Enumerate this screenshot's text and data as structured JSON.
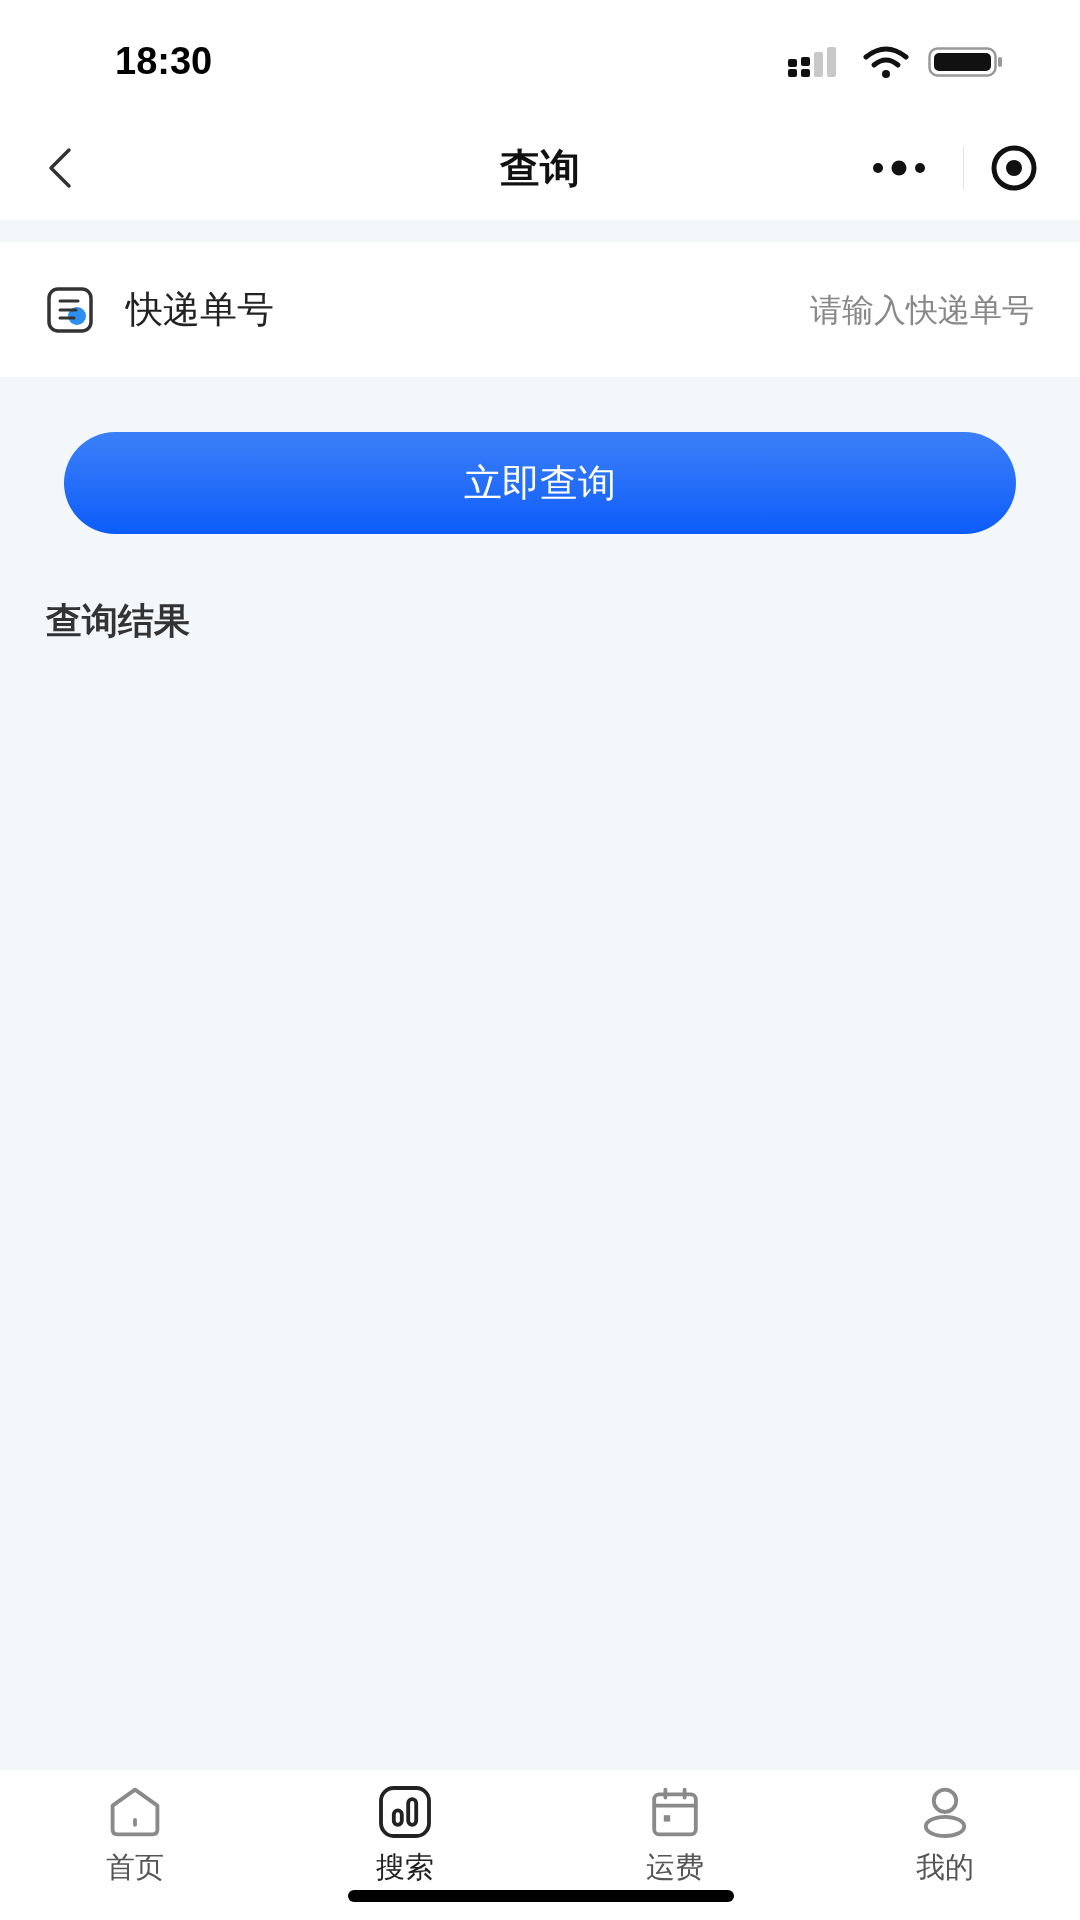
{
  "status_bar": {
    "time": "18:30"
  },
  "nav": {
    "title": "查询"
  },
  "form": {
    "label": "快递单号",
    "placeholder": "请输入快递单号"
  },
  "submit": {
    "label": "立即查询"
  },
  "results": {
    "heading": "查询结果"
  },
  "tabs": [
    {
      "kind": "home",
      "label": "首页",
      "selected": false
    },
    {
      "kind": "chart",
      "label": "搜索",
      "selected": true
    },
    {
      "kind": "calendar",
      "label": "运费",
      "selected": false
    },
    {
      "kind": "person",
      "label": "我的",
      "selected": false
    }
  ]
}
